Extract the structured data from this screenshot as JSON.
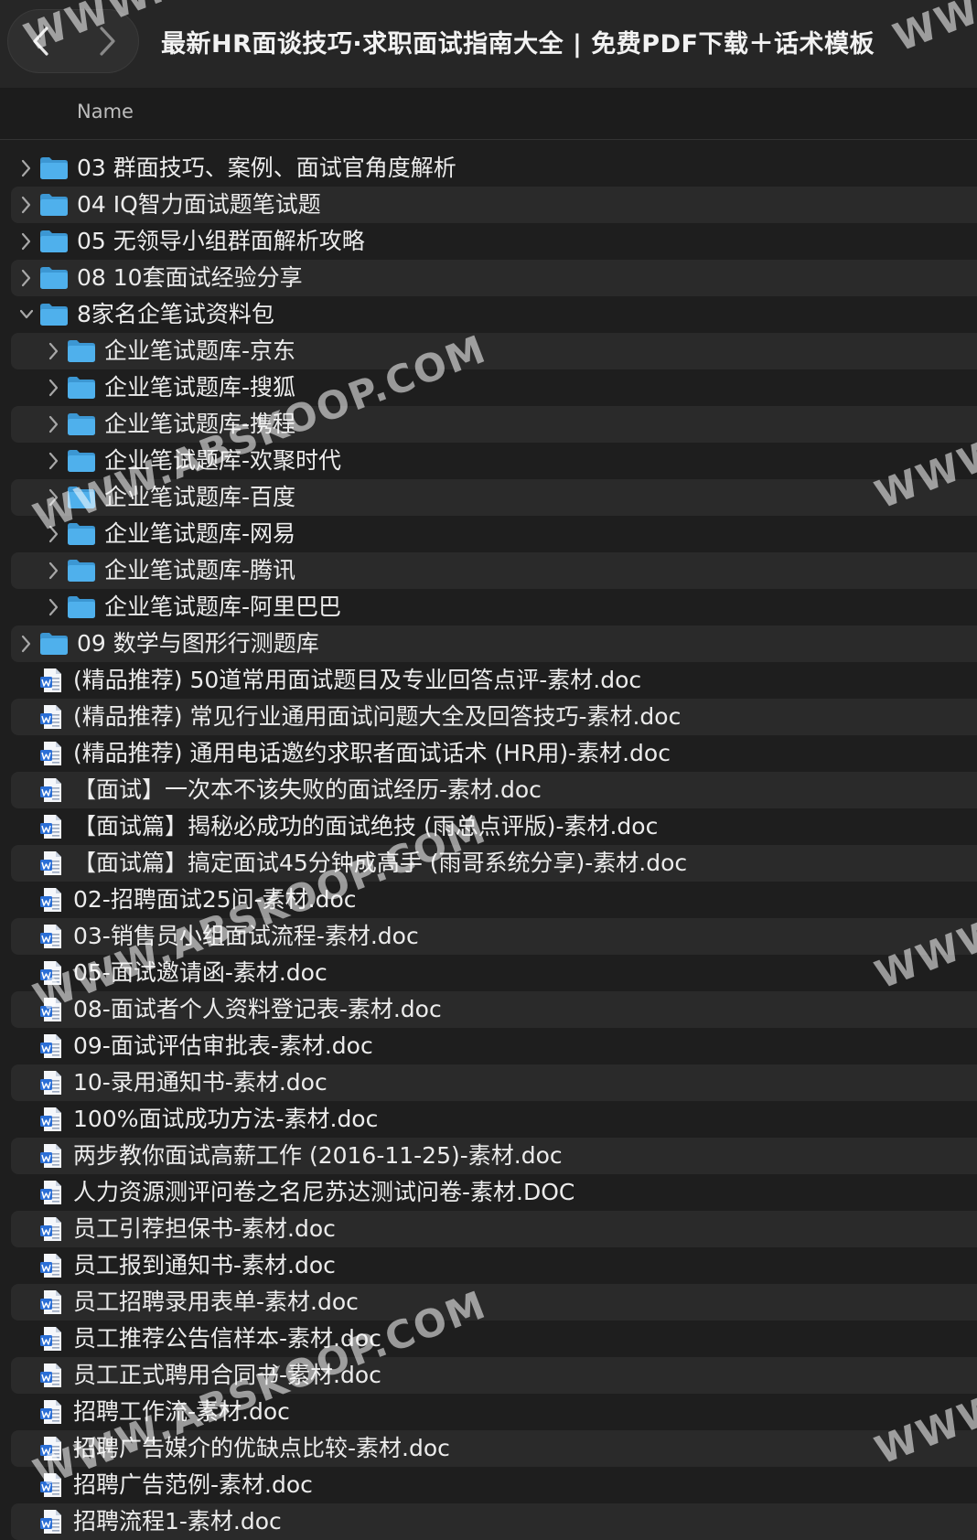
{
  "window": {
    "title": "最新HR面谈技巧·求职面试指南大全 | 免费PDF下载＋话术模板"
  },
  "column_header": {
    "name": "Name"
  },
  "rows": [
    {
      "label": "03 群面技巧、案例、面试官角度解析",
      "type": "folder",
      "level": 0,
      "expanded": false
    },
    {
      "label": "04 IQ智力面试题笔试题",
      "type": "folder",
      "level": 0,
      "expanded": false
    },
    {
      "label": "05 无领导小组群面解析攻略",
      "type": "folder",
      "level": 0,
      "expanded": false
    },
    {
      "label": "08 10套面试经验分享",
      "type": "folder",
      "level": 0,
      "expanded": false
    },
    {
      "label": "8家名企笔试资料包",
      "type": "folder",
      "level": 0,
      "expanded": true
    },
    {
      "label": "企业笔试题库-京东",
      "type": "folder",
      "level": 1,
      "expanded": false
    },
    {
      "label": "企业笔试题库-搜狐",
      "type": "folder",
      "level": 1,
      "expanded": false
    },
    {
      "label": "企业笔试题库-携程",
      "type": "folder",
      "level": 1,
      "expanded": false
    },
    {
      "label": "企业笔试题库-欢聚时代",
      "type": "folder",
      "level": 1,
      "expanded": false
    },
    {
      "label": "企业笔试题库-百度",
      "type": "folder",
      "level": 1,
      "expanded": false
    },
    {
      "label": "企业笔试题库-网易",
      "type": "folder",
      "level": 1,
      "expanded": false
    },
    {
      "label": "企业笔试题库-腾讯",
      "type": "folder",
      "level": 1,
      "expanded": false
    },
    {
      "label": "企业笔试题库-阿里巴巴",
      "type": "folder",
      "level": 1,
      "expanded": false
    },
    {
      "label": "09 数学与图形行测题库",
      "type": "folder",
      "level": 0,
      "expanded": false
    },
    {
      "label": "(精品推荐) 50道常用面试题目及专业回答点评-素材.doc",
      "type": "doc",
      "level": 0
    },
    {
      "label": "(精品推荐) 常见行业通用面试问题大全及回答技巧-素材.doc",
      "type": "doc",
      "level": 0
    },
    {
      "label": "(精品推荐) 通用电话邀约求职者面试话术 (HR用)-素材.doc",
      "type": "doc",
      "level": 0
    },
    {
      "label": "【面试】一次本不该失败的面试经历-素材.doc",
      "type": "doc",
      "level": 0
    },
    {
      "label": "【面试篇】揭秘必成功的面试绝技 (雨总点评版)-素材.doc",
      "type": "doc",
      "level": 0
    },
    {
      "label": "【面试篇】搞定面试45分钟成高手 (雨哥系统分享)-素材.doc",
      "type": "doc",
      "level": 0
    },
    {
      "label": "02-招聘面试25问-素材.doc",
      "type": "doc",
      "level": 0
    },
    {
      "label": "03-销售员小组面试流程-素材.doc",
      "type": "doc",
      "level": 0
    },
    {
      "label": "05-面试邀请函-素材.doc",
      "type": "doc",
      "level": 0
    },
    {
      "label": "08-面试者个人资料登记表-素材.doc",
      "type": "doc",
      "level": 0
    },
    {
      "label": "09-面试评估审批表-素材.doc",
      "type": "doc",
      "level": 0
    },
    {
      "label": "10-录用通知书-素材.doc",
      "type": "doc",
      "level": 0
    },
    {
      "label": "100%面试成功方法-素材.doc",
      "type": "doc",
      "level": 0
    },
    {
      "label": "两步教你面试高薪工作 (2016-11-25)-素材.doc",
      "type": "doc",
      "level": 0
    },
    {
      "label": "人力资源测评问卷之名尼苏达测试问卷-素材.DOC",
      "type": "doc",
      "level": 0
    },
    {
      "label": "员工引荐担保书-素材.doc",
      "type": "doc",
      "level": 0
    },
    {
      "label": "员工报到通知书-素材.doc",
      "type": "doc",
      "level": 0
    },
    {
      "label": "员工招聘录用表单-素材.doc",
      "type": "doc",
      "level": 0
    },
    {
      "label": "员工推荐公告信样本-素材.doc",
      "type": "doc",
      "level": 0
    },
    {
      "label": "员工正式聘用合同书-素材.doc",
      "type": "doc",
      "level": 0
    },
    {
      "label": "招聘工作流-素材.doc",
      "type": "doc",
      "level": 0
    },
    {
      "label": "招聘广告媒介的优缺点比较-素材.doc",
      "type": "doc",
      "level": 0
    },
    {
      "label": "招聘广告范例-素材.doc",
      "type": "doc",
      "level": 0
    },
    {
      "label": "招聘流程1-素材.doc",
      "type": "doc",
      "level": 0
    }
  ],
  "watermarks": [
    "WWW.ABSKOOP.COM",
    "WWW."
  ],
  "colors": {
    "folder": "#4fb0ec",
    "folder_tab": "#3c97d3",
    "doc_accent": "#2b6fd6",
    "stripe": "#2a2a2a",
    "background": "#1e1e1e"
  }
}
